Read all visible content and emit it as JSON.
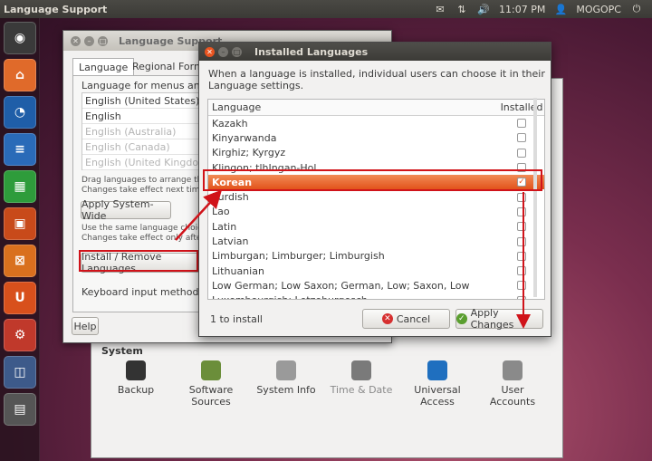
{
  "top_panel": {
    "title": "Language Support",
    "time": "11:07 PM",
    "user": "MOGOPC"
  },
  "launcher": [
    {
      "name": "dash-icon",
      "color": "#3a3a3a"
    },
    {
      "name": "home-folder-icon",
      "color": "#e06a2a"
    },
    {
      "name": "firefox-icon",
      "color": "#1f5ea8"
    },
    {
      "name": "writer-icon",
      "color": "#2a6bb8"
    },
    {
      "name": "calc-icon",
      "color": "#2e9c3b"
    },
    {
      "name": "impress-icon",
      "color": "#c84a1a"
    },
    {
      "name": "software-center-icon",
      "color": "#d9701e"
    },
    {
      "name": "ubuntu-one-icon",
      "color": "#d8501c"
    },
    {
      "name": "system-settings-icon",
      "color": "#c0392b"
    },
    {
      "name": "workspace-switcher-icon",
      "color": "#3d5a8a"
    },
    {
      "name": "workspaces-icon",
      "color": "#555555"
    }
  ],
  "system_settings": {
    "heading": "System",
    "items": [
      {
        "label1": "Backup",
        "label2": "",
        "dim": false
      },
      {
        "label1": "Software",
        "label2": "Sources",
        "dim": false
      },
      {
        "label1": "System Info",
        "label2": "",
        "dim": false
      },
      {
        "label1": "Time & Date",
        "label2": "",
        "dim": true
      },
      {
        "label1": "Universal",
        "label2": "Access",
        "dim": false
      },
      {
        "label1": "User",
        "label2": "Accounts",
        "dim": false
      }
    ]
  },
  "language_support": {
    "title": "Language Support",
    "tab_language": "Language",
    "tab_regional": "Regional Forma",
    "menus_label": "Language for menus and win",
    "languages": [
      {
        "label": "English (United States)",
        "dim": false
      },
      {
        "label": "English",
        "dim": false
      },
      {
        "label": "English (Australia)",
        "dim": true
      },
      {
        "label": "English (Canada)",
        "dim": true
      },
      {
        "label": "English (United Kingdom)",
        "dim": true
      }
    ],
    "drag_hint1": "Drag languages to arrange them i",
    "drag_hint2": "Changes take effect next time yo",
    "apply_system_wide": "Apply System-Wide",
    "same_choice1": "Use the same language choice fo",
    "same_choice2": "Changes take effect only after a r",
    "install_remove": "Install / Remove Languages",
    "keyboard_label": "Keyboard input method syst",
    "help": "Help"
  },
  "installed_languages": {
    "title": "Installed Languages",
    "description": "When a language is installed, individual users can choose it in their Language settings.",
    "col_language": "Language",
    "col_installed": "Installed",
    "rows": [
      {
        "name": "Kazakh",
        "installed": false,
        "selected": false
      },
      {
        "name": "Kinyarwanda",
        "installed": false,
        "selected": false
      },
      {
        "name": "Kirghiz; Kyrgyz",
        "installed": false,
        "selected": false
      },
      {
        "name": "Klingon; tlhIngan-Hol",
        "installed": false,
        "selected": false
      },
      {
        "name": "Korean",
        "installed": true,
        "selected": true
      },
      {
        "name": "Kurdish",
        "installed": false,
        "selected": false
      },
      {
        "name": "Lao",
        "installed": false,
        "selected": false
      },
      {
        "name": "Latin",
        "installed": false,
        "selected": false
      },
      {
        "name": "Latvian",
        "installed": false,
        "selected": false
      },
      {
        "name": "Limburgan; Limburger; Limburgish",
        "installed": false,
        "selected": false
      },
      {
        "name": "Lithuanian",
        "installed": false,
        "selected": false
      },
      {
        "name": "Low German; Low Saxon; German, Low; Saxon, Low",
        "installed": false,
        "selected": false
      },
      {
        "name": "Luxembourgish; Letzeburgesch",
        "installed": false,
        "selected": false
      }
    ],
    "status": "1 to install",
    "cancel": "Cancel",
    "apply": "Apply Changes"
  }
}
